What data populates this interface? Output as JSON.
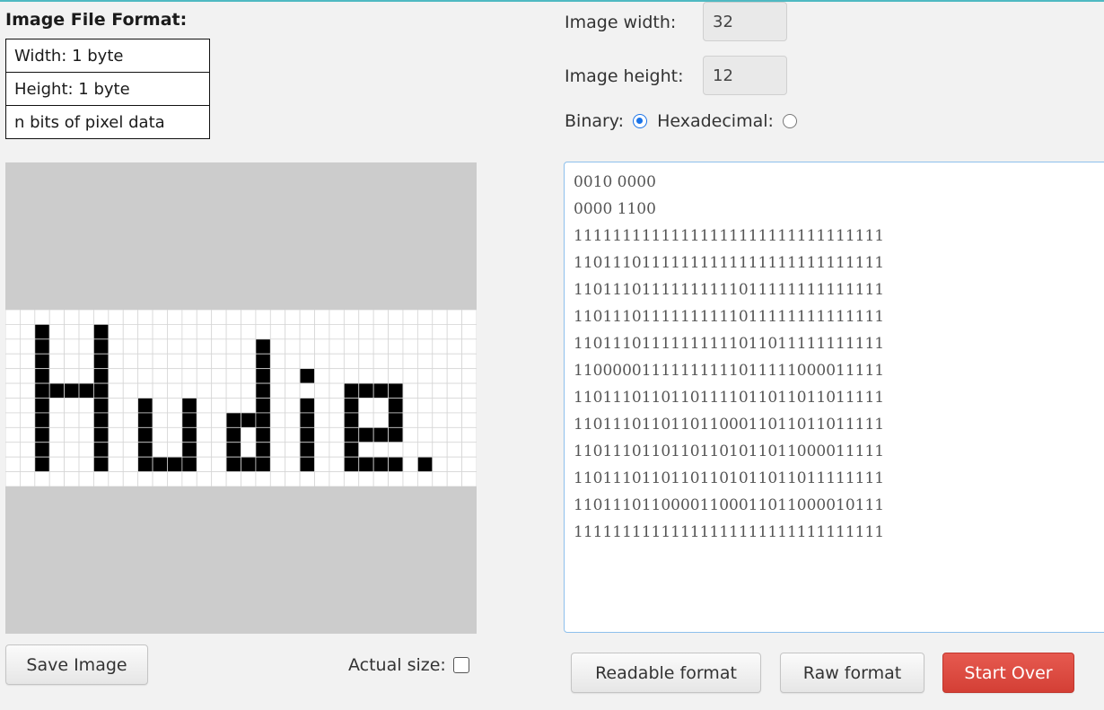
{
  "format": {
    "heading": "Image File Format:",
    "rows": [
      "Width: 1 byte",
      "Height: 1 byte",
      "n bits of pixel data"
    ]
  },
  "controls": {
    "width_label": "Image width:",
    "width_value": "32",
    "height_label": "Image height:",
    "height_value": "12",
    "binary_label": "Binary:",
    "hex_label": "Hexadecimal:",
    "selected_mode": "Binary"
  },
  "data_text": "0010 0000\n0000 1100\n11111111111111111111111111111111\n11011101111111111111111111111111\n11011101111111111011111111111111\n11011101111111111011111111111111\n11011101111111111011011111111111\n11000001111111111011111000011111\n11011101101101111011011011011111\n11011101101101100011011011011111\n11011101101101101011011000011111\n11011101101101101011011011111111\n11011101100001100011011000010111\n11111111111111111111111111111111",
  "pixel_rows": [
    "11111111111111111111111111111111",
    "11011101111111111111111111111111",
    "11011101111111111011111111111111",
    "11011101111111111011111111111111",
    "11011101111111111011011111111111",
    "11000001111111111011111000011111",
    "11011101101101111011011011011111",
    "11011101101101100011011011011111",
    "11011101101101101011011000011111",
    "11011101101101101011011011111111",
    "11011101100001100011011000010111",
    "11111111111111111111111111111111"
  ],
  "buttons": {
    "save_image": "Save Image",
    "actual_size_label": "Actual size:",
    "readable_format": "Readable format",
    "raw_format": "Raw format",
    "start_over": "Start Over"
  },
  "colors": {
    "accent": "#1a73e8",
    "danger": "#d9453b",
    "pixel_on": "#ffffff",
    "pixel_off": "#000000",
    "grid_line": "#d6d6d6",
    "canvas_background": "#cccccc"
  }
}
